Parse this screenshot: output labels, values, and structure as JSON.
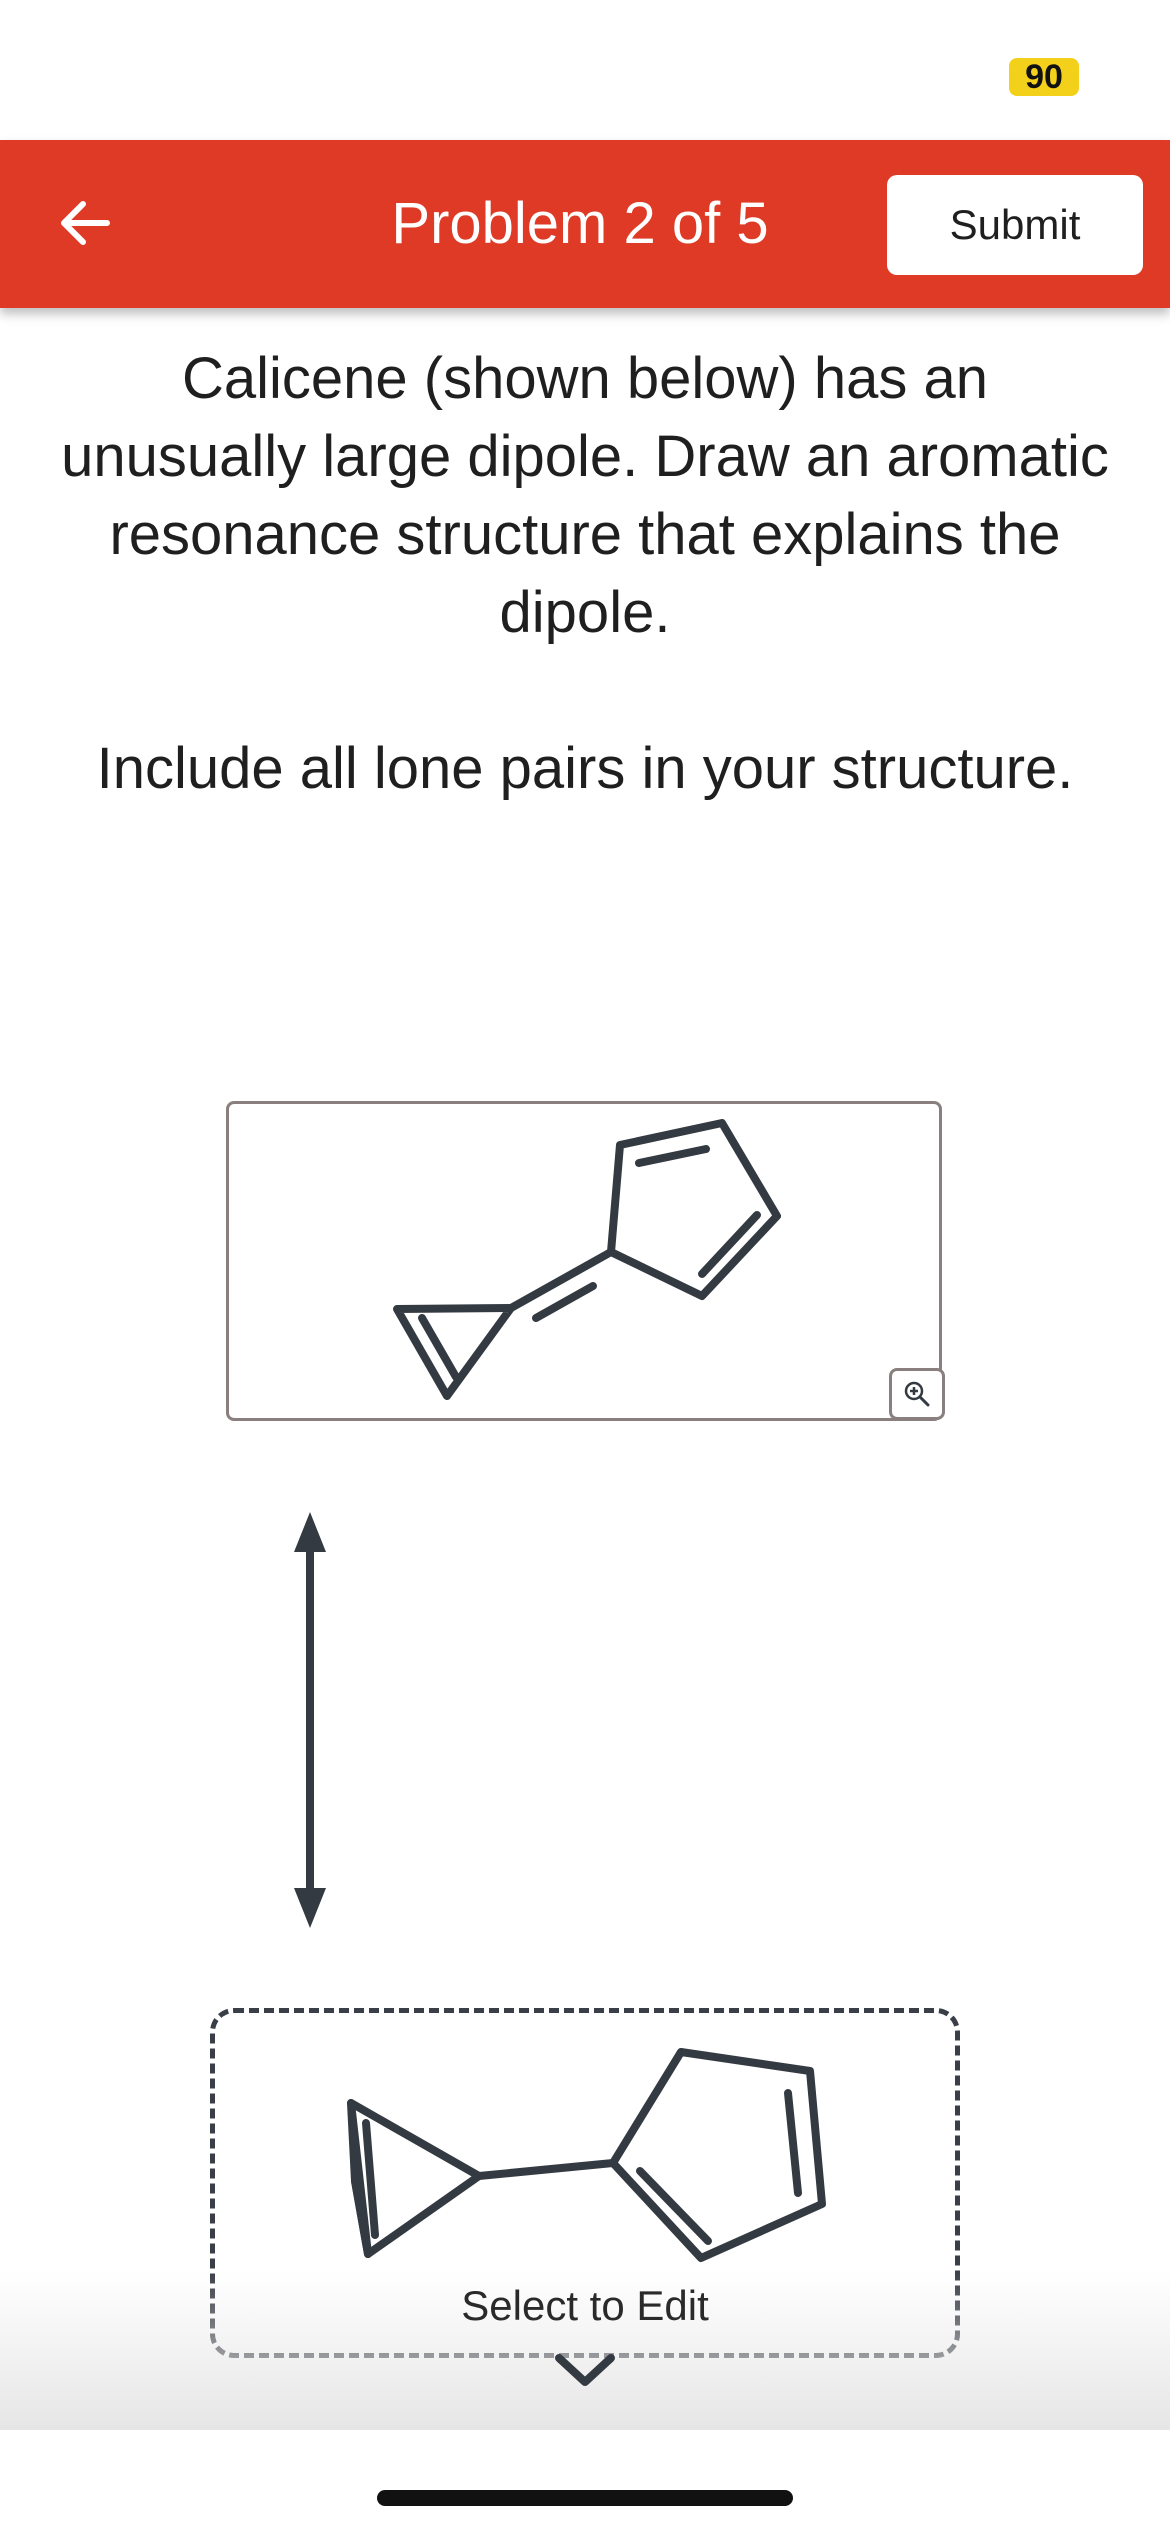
{
  "status": {
    "badge_count": "90",
    "badge_color": "#f3d11b"
  },
  "header": {
    "title": "Problem 2 of 5",
    "submit_label": "Submit",
    "back_icon": "arrow-left-icon",
    "bg_color": "#de3a26"
  },
  "question": {
    "prompt": "Calicene (shown below) has an unusually large dipole. Draw an aromatic resonance structure that explains the dipole.",
    "note": "Include all lone pairs in your structure."
  },
  "given_structure": {
    "molecule": "calicene",
    "zoom_icon": "zoom-in-icon"
  },
  "resonance_arrow_icon": "double-headed-arrow-icon",
  "answer": {
    "edit_label": "Select to Edit",
    "expand_icon": "chevron-down-icon"
  }
}
